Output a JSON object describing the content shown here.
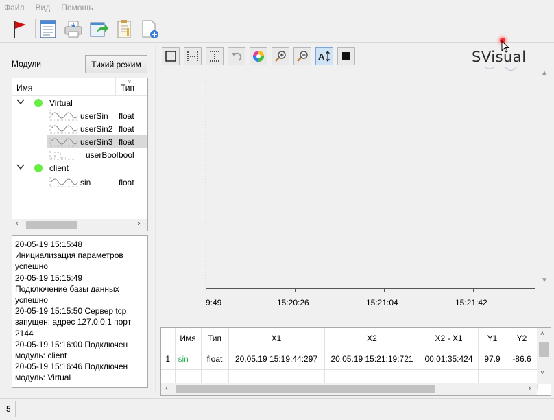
{
  "menu": [
    "Файл",
    "Вид",
    "Помощь"
  ],
  "toolbar_icons": [
    "flag-icon",
    "document-list-icon",
    "printer-icon",
    "export-icon",
    "clipboard-icon",
    "add-document-icon"
  ],
  "left": {
    "modules_label": "Модули",
    "quiet_mode_button": "Тихий режим",
    "tree_headers": {
      "name": "Имя",
      "type": "Тип"
    },
    "groups": [
      {
        "name": "Virtual",
        "signals": [
          {
            "name": "userSin",
            "type": "float",
            "selected": false,
            "kind": "wave"
          },
          {
            "name": "userSin2",
            "type": "float",
            "selected": false,
            "kind": "wave"
          },
          {
            "name": "userSin3",
            "type": "float",
            "selected": true,
            "kind": "wave"
          },
          {
            "name": "userBool",
            "type": "bool",
            "selected": false,
            "kind": "step"
          }
        ]
      },
      {
        "name": "client",
        "signals": [
          {
            "name": "sin",
            "type": "float",
            "selected": false,
            "kind": "wave"
          }
        ]
      }
    ],
    "log_lines": [
      "20-05-19 15:15:48",
      "Инициализация параметров",
      "успешно",
      "20-05-19 15:15:49",
      "Подключение базы данных",
      "успешно",
      "20-05-19 15:15:50 Сервер tcp",
      "запущен: адрес 127.0.0.1 порт",
      "2144",
      "20-05-19 15:16:00 Подключен",
      "модуль: client",
      "20-05-19 15:16:46 Подключен",
      "модуль: Virtual"
    ]
  },
  "graph": {
    "brand": "SVisual",
    "buttons": [
      "select-rect-icon",
      "fit-horizontal-icon",
      "fit-vertical-icon",
      "undo-icon",
      "color-wheel-icon",
      "zoom-in-icon",
      "zoom-out-icon",
      "auto-scale-icon",
      "stop-icon"
    ],
    "x_ticks": [
      "9:49",
      "15:20:26",
      "15:21:04",
      "15:21:42"
    ]
  },
  "table": {
    "headers": [
      "",
      "Имя",
      "Тип",
      "X1",
      "X2",
      "X2 - X1",
      "Y1",
      "Y2"
    ],
    "rows": [
      {
        "num": "1",
        "name": "sin",
        "type": "float",
        "x1": "20.05.19 15:19:44:297",
        "x2": "20.05.19 15:21:19:721",
        "dx": "00:01:35:424",
        "y1": "97.9",
        "y2": "-86.6"
      }
    ]
  },
  "status": {
    "value": "5"
  },
  "colors": {
    "accent_green": "#66ee44",
    "name_green": "#2fb45a",
    "brand_dot": "#ff2a2a"
  }
}
